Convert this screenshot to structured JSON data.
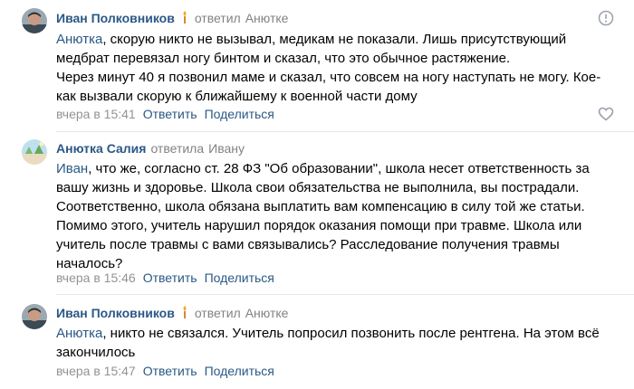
{
  "comments": [
    {
      "author": "Иван Полковников",
      "replied_label": "ответил",
      "reply_to": "Анютке",
      "mention": "Анютка",
      "text_rest": ", скорую никто не вызывал, медикам не показали. Лишь присутствующий\nмедбрат перевязал ногу бинтом и сказал, что это обычное растяжение.\nЧерез минут 40 я позвонил маме и сказал, что совсем на ногу наступать не могу. Кое-\nкак вызвали скорую к ближайшему к военной части дому",
      "date": "вчера в 15:41",
      "reply_label": "Ответить",
      "share_label": "Поделиться"
    },
    {
      "author": "Анютка Салия",
      "replied_label": "ответила",
      "reply_to": "Ивану",
      "mention": "Иван",
      "text_rest": ", что же, согласно ст. 28 ФЗ \"Об образовании\", школа несет ответственность за\nвашу жизнь и здоровье. Школа свои обязательства не выполнила, вы пострадали.\nСоответственно, школа обязана выплатить вам компенсацию в силу той же статьи.\nПомимо этого, учитель нарушил порядок оказания помощи при травме. Школа или\nучитель после травмы с вами связывались? Расследование получения травмы\nначалось?",
      "date": "вчера в 15:46",
      "reply_label": "Ответить",
      "share_label": "Поделиться"
    },
    {
      "author": "Иван Полковников",
      "replied_label": "ответил",
      "reply_to": "Анютке",
      "mention": "Анютка",
      "text_rest": ", никто не связался. Учитель попросил позвонить после рентгена. На этом всё\nзакончилось",
      "date": "вчера в 15:47",
      "reply_label": "Ответить",
      "share_label": "Поделиться"
    }
  ],
  "icons": {
    "report": "report-icon",
    "like": "heart-icon",
    "author_badge": "torch-icon"
  },
  "colors": {
    "link": "#2a5885",
    "secondary": "#828282",
    "divider": "#e7e8ec"
  }
}
